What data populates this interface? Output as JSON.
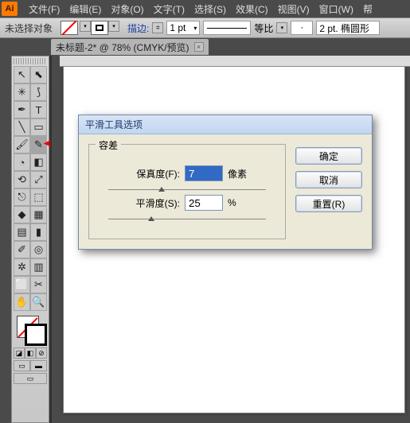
{
  "menu": {
    "items": [
      "文件(F)",
      "编辑(E)",
      "对象(O)",
      "文字(T)",
      "选择(S)",
      "效果(C)",
      "视图(V)",
      "窗口(W)",
      "帮"
    ]
  },
  "ai_logo": "Ai",
  "control": {
    "selection": "未选择对象",
    "stroke_label": "描边:",
    "pt": "1 pt",
    "ratio_label": "等比",
    "ratio_value": "",
    "shape": "2 pt. 椭圆形"
  },
  "tab": {
    "title": "未标题-2* @ 78% (CMYK/预览)"
  },
  "dialog": {
    "title": "平滑工具选项",
    "legend": "容差",
    "fidelity_label": "保真度(F):",
    "fidelity_value": "7",
    "fidelity_unit": "像素",
    "smooth_label": "平滑度(S):",
    "smooth_value": "25",
    "smooth_unit": "%",
    "ok": "确定",
    "cancel": "取消",
    "reset": "重置(R)"
  }
}
